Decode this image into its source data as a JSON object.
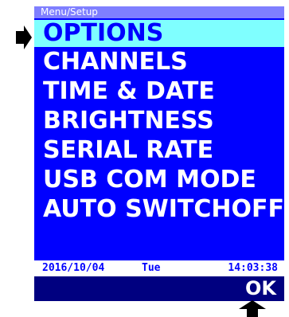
{
  "header": {
    "title": "Menu/Setup"
  },
  "menu": {
    "items": [
      {
        "label": "OPTIONS",
        "selected": true
      },
      {
        "label": "CHANNELS",
        "selected": false
      },
      {
        "label": "TIME & DATE",
        "selected": false
      },
      {
        "label": "BRIGHTNESS",
        "selected": false
      },
      {
        "label": "SERIAL RATE",
        "selected": false
      },
      {
        "label": "USB COM MODE",
        "selected": false
      },
      {
        "label": "AUTO SWITCHOFF",
        "selected": false
      }
    ]
  },
  "status": {
    "date": "2016/10/04",
    "day": "Tue",
    "time": "14:03:38"
  },
  "softkey": {
    "ok_label": "OK"
  },
  "icons": {
    "left_pointer": "arrow-right-icon",
    "bottom_pointer": "arrow-up-icon"
  },
  "colors": {
    "screen_bg": "#0000ff",
    "header_bg": "#7f7fff",
    "selected_bg": "#7fffff",
    "softkey_bar_bg": "#000080",
    "text": "#ffffff"
  }
}
